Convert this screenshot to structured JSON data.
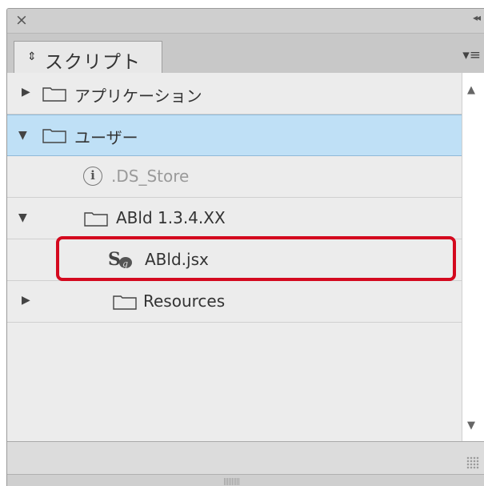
{
  "panel": {
    "title_close": "×",
    "collapse": "◂◂",
    "tab": {
      "arrows": "⇕",
      "label": "スクリプト"
    },
    "menu": "▾≡",
    "colors": {
      "selected_row": "#bfe0f6",
      "highlight": "#d4091e"
    }
  },
  "tree": [
    {
      "label": "アプリケーション",
      "icon": "folder-icon",
      "expanded": false
    },
    {
      "label": "ユーザー",
      "icon": "folder-icon",
      "expanded": true,
      "selected": true
    },
    {
      "label": ".DS_Store",
      "icon": "info-icon"
    },
    {
      "label": "ABld 1.3.4.XX",
      "icon": "folder-icon",
      "expanded": true
    },
    {
      "label": "ABld.jsx",
      "icon": "script-icon"
    },
    {
      "label": "Resources",
      "icon": "folder-icon",
      "expanded": false
    }
  ],
  "footer": {
    "handle": "||||||||||"
  }
}
